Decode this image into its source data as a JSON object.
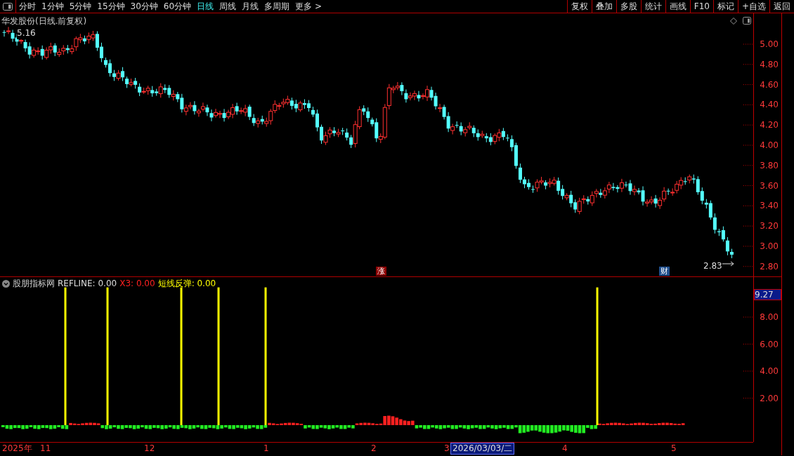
{
  "toolbar": {
    "periods": [
      {
        "label": "分时",
        "selected": false
      },
      {
        "label": "1分钟",
        "selected": false
      },
      {
        "label": "5分钟",
        "selected": false
      },
      {
        "label": "15分钟",
        "selected": false
      },
      {
        "label": "30分钟",
        "selected": false
      },
      {
        "label": "60分钟",
        "selected": false
      },
      {
        "label": "日线",
        "selected": true
      },
      {
        "label": "周线",
        "selected": false
      },
      {
        "label": "月线",
        "selected": false
      },
      {
        "label": "多周期",
        "selected": false
      },
      {
        "label": "更多 >",
        "selected": false
      }
    ],
    "buttons": [
      "复权",
      "叠加",
      "多股",
      "统计",
      "画线",
      "F10",
      "标记",
      "+自选",
      "返回"
    ]
  },
  "price_panel": {
    "title": "华发股份(日线.前复权)",
    "high_label": "5.16",
    "low_label": "2.83",
    "markers": [
      {
        "text": "涨",
        "color": "#8b0000"
      },
      {
        "text": "财",
        "color": "#1f4e8c"
      }
    ],
    "axis": [
      "5.00",
      "4.80",
      "4.60",
      "4.40",
      "4.20",
      "4.00",
      "3.80",
      "3.60",
      "3.40",
      "3.20",
      "3.00",
      "2.80"
    ]
  },
  "indicator_panel": {
    "title": "股朋指标网",
    "values": [
      {
        "text": "REFLINE: 0.00",
        "color": "#dddddd"
      },
      {
        "text": "X3: 0.00",
        "color": "#ff2020"
      },
      {
        "text": "短线反弹: 0.00",
        "color": "#ffff00"
      }
    ],
    "current_value": "9.27",
    "axis": [
      "8.00",
      "6.00",
      "4.00",
      "2.00"
    ]
  },
  "date_axis": [
    {
      "label": "2025年",
      "selected": false
    },
    {
      "label": "11",
      "selected": false
    },
    {
      "label": "12",
      "selected": false
    },
    {
      "label": "1",
      "selected": false
    },
    {
      "label": "2",
      "selected": false
    },
    {
      "label": "3",
      "selected": false
    },
    {
      "label": "2026/03/03/二",
      "selected": true
    },
    {
      "label": "4",
      "selected": false
    },
    {
      "label": "5",
      "selected": false
    }
  ]
}
